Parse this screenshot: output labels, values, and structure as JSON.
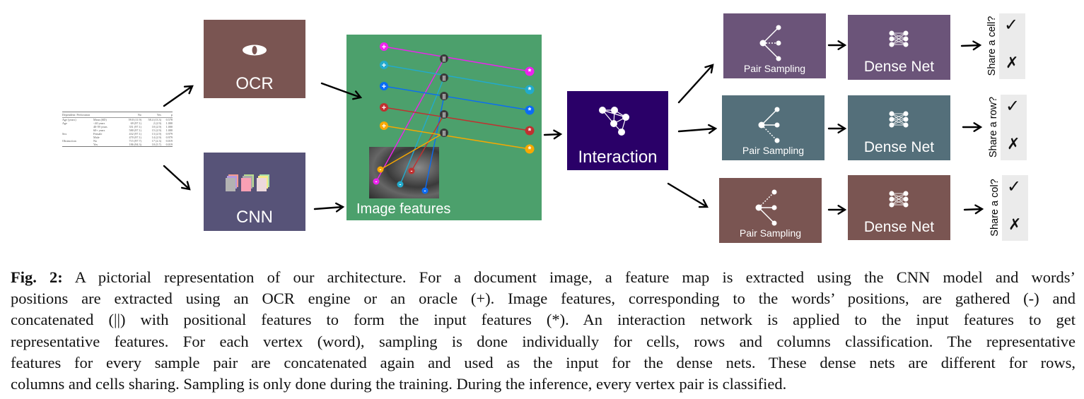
{
  "table": {
    "header": [
      "Dependent: Perforation",
      "",
      "No",
      "Yes",
      "p"
    ],
    "rows": [
      [
        "Age (years)",
        "Mean (SD)",
        "59.8 (11.9)",
        "58.4 (13.3)",
        "0.578"
      ],
      [
        "Age",
        "<40 years",
        "69 (97.1)",
        "2 (2.9)",
        "1.000"
      ],
      [
        "",
        "40-59 years",
        "351 (97.1)",
        "10 (2.9)",
        "1.000"
      ],
      [
        "",
        "60+ years",
        "580 (97.1)",
        "15 (2.9)",
        "1.000"
      ],
      [
        "Sex",
        "Female",
        "432 (97.1)",
        "13 (2.9)",
        "0.979"
      ],
      [
        "",
        "Male",
        "470 (97.1)",
        "14 (2.9)",
        "0.979"
      ],
      [
        "Obstruction",
        "No",
        "715 (97.7)",
        "17 (2.3)",
        "0.019"
      ],
      [
        "",
        "Yes",
        "186 (94.3)",
        "10 (5.7)",
        "0.019"
      ]
    ]
  },
  "ocr": {
    "label": "OCR",
    "icon": "eye-icon",
    "color": "#7a5552"
  },
  "cnn": {
    "label": "CNN",
    "icon": "feature-maps-icon",
    "color": "#575378"
  },
  "image_features": {
    "label": "Image features",
    "color": "#4ca06c",
    "symbols": {
      "position": "+",
      "gathered": "-",
      "concat": "||",
      "input": "*"
    },
    "word_colors": [
      "#ee22ee",
      "#22aacc",
      "#0a6cf5",
      "#c03030",
      "#f8a800"
    ],
    "concat_color": "#3a3a3a"
  },
  "interaction": {
    "label": "Interaction",
    "icon": "graph-icon",
    "color": "#2a0068"
  },
  "branches": [
    {
      "sampling_label": "Pair Sampling",
      "dense_label": "Dense Net",
      "question": "Share a cell?",
      "color": "#6b5479",
      "yes": "✓",
      "no": "✗"
    },
    {
      "sampling_label": "Pair Sampling",
      "dense_label": "Dense Net",
      "question": "Share a row?",
      "color": "#546f7a",
      "yes": "✓",
      "no": "✗"
    },
    {
      "sampling_label": "Pair Sampling",
      "dense_label": "Dense Net",
      "question": "Share a col?",
      "color": "#7a5552",
      "yes": "✓",
      "no": "✗"
    }
  ],
  "caption": {
    "label": "Fig. 2:",
    "lines": [
      " A pictorial representation of our architecture. For a document image, a feature map is extracted using the CNN model and words’",
      "positions are extracted using an OCR engine or an oracle (+). Image features, corresponding to the words’ positions, are gathered (-) and",
      "concatenated (||) with positional features to form the input features (*). An interaction network is applied to the input features to get",
      "representative features. For each vertex (word), sampling is done individually for cells, rows and columns classification. The representative",
      "features for every sample pair are concatenated again and used as the input for the dense nets. These dense nets are different for rows,",
      "columns and cells sharing. Sampling is only done during the training. During the inference, every vertex pair is classified."
    ]
  }
}
